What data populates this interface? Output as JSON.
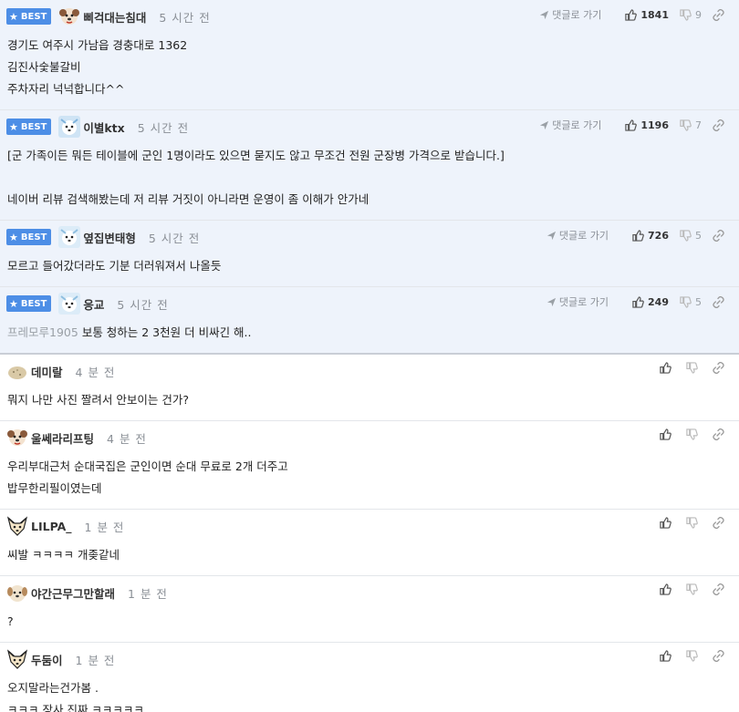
{
  "labels": {
    "best": "BEST",
    "reply": "댓글로 가기"
  },
  "colors": {
    "best_bg": "#eef3fb",
    "badge": "#4d8ee6",
    "normal_bg": "#ffffff"
  },
  "best": [
    {
      "nick": "삐걱대는침대",
      "time": "5 시간 전",
      "avatar_icon": "dog-face-icon",
      "up": "1841",
      "down": "9",
      "lines": [
        "경기도 여주시 가남읍 경충대로 1362",
        "김진사숯불갈비",
        "주차자리 넉넉합니다^^"
      ]
    },
    {
      "nick": "이별ktx",
      "time": "5 시간 전",
      "avatar_icon": "dog-face-icon",
      "up": "1196",
      "down": "7",
      "lines": [
        "[군 가족이든 뭐든 테이블에 군인 1명이라도 있으면 묻지도 않고 무조건 전원 군장병 가격으로 받습니다.]",
        "",
        "네이버 리뷰 검색해봤는데 저 리뷰 거짓이 아니라면 운영이 좀 이해가 안가네"
      ]
    },
    {
      "nick": "옆집변태형",
      "time": "5 시간 전",
      "avatar_icon": "dog-face-icon",
      "up": "726",
      "down": "5",
      "lines": [
        "모르고 들어갔더라도 기분 더러워져서 나올듯"
      ]
    },
    {
      "nick": "응교",
      "time": "5 시간 전",
      "avatar_icon": "dog-face-icon",
      "up": "249",
      "down": "5",
      "ref": "프레모루1905",
      "lines": [
        "보통 청하는 2 3천원 더 비싸긴 해.."
      ]
    }
  ],
  "comments": [
    {
      "nick": "데미랄",
      "time": "4 분 전",
      "avatar_icon": "potato-icon",
      "lines": [
        "뭐지 나만 사진 짤려서 안보이는 건가?"
      ]
    },
    {
      "nick": "울쎄라리프팅",
      "time": "4 분 전",
      "avatar_icon": "dog-face-icon",
      "lines": [
        "우리부대근처 순대국집은 군인이면 순대 무료로 2개 더주고",
        "밥무한리필이였는데"
      ]
    },
    {
      "nick": "LILPA_",
      "time": "1 분 전",
      "avatar_icon": "fox-face-icon",
      "lines": [
        "씨발 ㅋㅋㅋㅋ 개좆같네"
      ]
    },
    {
      "nick": "야간근무그만할래",
      "time": "1 분 전",
      "avatar_icon": "dog-face-icon",
      "lines": [
        "?"
      ]
    },
    {
      "nick": "두둠이",
      "time": "1 분 전",
      "avatar_icon": "fox-face-icon",
      "lines": [
        "오지말라는건가봄 .",
        "ㅋㅋㅋ 장사 진짜 ㅋㅋㅋㅋㅋ"
      ]
    }
  ]
}
